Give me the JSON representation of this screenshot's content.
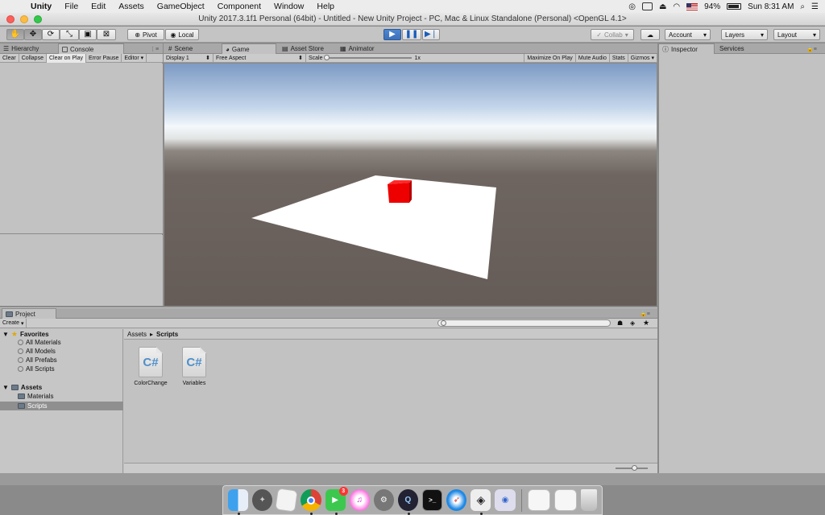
{
  "menubar": {
    "items": [
      "Unity",
      "File",
      "Edit",
      "Assets",
      "GameObject",
      "Component",
      "Window",
      "Help"
    ],
    "battery": "94%",
    "clock": "Sun 8:31 AM"
  },
  "window": {
    "title": "Unity 2017.3.1f1 Personal (64bit) - Untitled - New Unity Project - PC, Mac & Linux Standalone (Personal) <OpenGL 4.1>"
  },
  "toolbar": {
    "pivot": "Pivot",
    "local": "Local",
    "collab": "Collab",
    "account": "Account",
    "layers": "Layers",
    "layout": "Layout"
  },
  "hierarchy_tabs": {
    "hierarchy": "Hierarchy",
    "console": "Console"
  },
  "console_bar": {
    "clear": "Clear",
    "collapse": "Collapse",
    "clear_on_play": "Clear on Play",
    "error_pause": "Error Pause",
    "editor": "Editor"
  },
  "center_tabs": {
    "scene": "Scene",
    "game": "Game",
    "asset_store": "Asset Store",
    "animator": "Animator"
  },
  "game_bar": {
    "display": "Display 1",
    "aspect": "Free Aspect",
    "scale_label": "Scale",
    "scale_value": "1x",
    "maximize": "Maximize On Play",
    "mute": "Mute Audio",
    "stats": "Stats",
    "gizmos": "Gizmos"
  },
  "inspector_tabs": {
    "inspector": "Inspector",
    "services": "Services"
  },
  "project": {
    "tab": "Project",
    "create": "Create",
    "favorites_label": "Favorites",
    "favorites": [
      "All Materials",
      "All Models",
      "All Prefabs",
      "All Scripts"
    ],
    "assets_label": "Assets",
    "folders": [
      "Materials",
      "Scripts"
    ],
    "breadcrumb_root": "Assets",
    "breadcrumb_current": "Scripts",
    "files": [
      "ColorChange",
      "Variables"
    ],
    "file_icon": "C#"
  },
  "dock": {
    "badge_count": "3"
  },
  "colors": {
    "cube": "#ee0000",
    "plane": "#ffffff",
    "accent": "#3d70b8"
  }
}
